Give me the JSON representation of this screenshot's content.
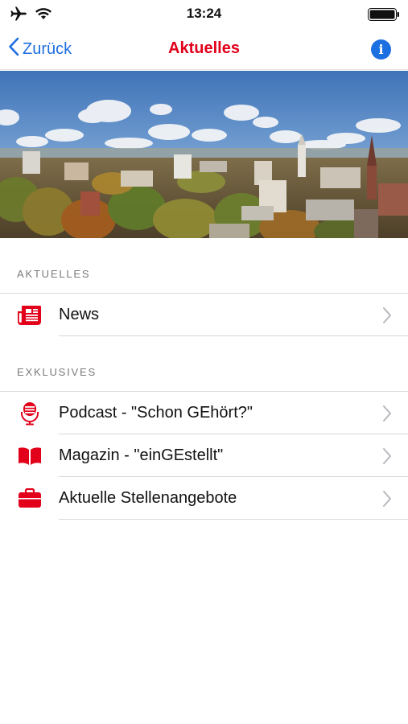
{
  "status_bar": {
    "time": "13:24"
  },
  "nav": {
    "back_label": "Zurück",
    "title": "Aktuelles",
    "info_label": "i"
  },
  "sections": [
    {
      "header": "AKTUELLES",
      "items": [
        {
          "label": "News",
          "icon": "newspaper-icon"
        }
      ]
    },
    {
      "header": "EXKLUSIVES",
      "items": [
        {
          "label": "Podcast - \"Schon GEhört?\"",
          "icon": "microphone-icon"
        },
        {
          "label": "Magazin - \"einGEstellt\"",
          "icon": "open-book-icon"
        },
        {
          "label": "Aktuelle Stellenangebote",
          "icon": "briefcase-icon"
        }
      ]
    }
  ],
  "colors": {
    "brand_red": "#e2001a",
    "link_blue": "#1f6fe0",
    "separator": "#d8d8d8",
    "section_header": "#7a7a7a"
  }
}
